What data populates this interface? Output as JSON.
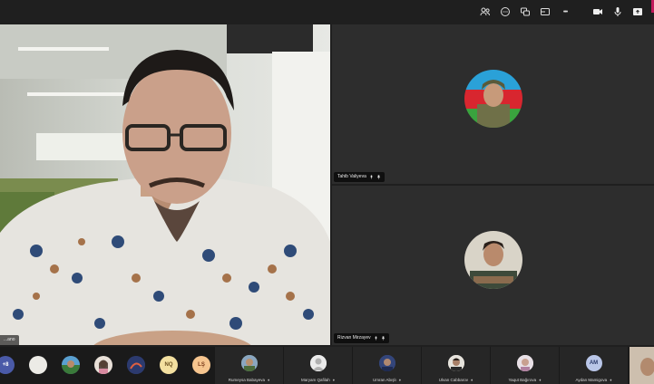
{
  "top_bar": {
    "icons": [
      "people-icon",
      "chat-icon",
      "reactions-icon",
      "rooms-icon",
      "more-icon",
      "camera-icon",
      "mic-icon",
      "share-icon"
    ],
    "more_label": "•••"
  },
  "main_video": {
    "name_tag": "...ano"
  },
  "tiles": [
    {
      "name": "Tahib Valiyeva"
    },
    {
      "name": "Rizvan Mirzayev"
    }
  ],
  "bottom_strip": {
    "overflow_count": "+8",
    "initials": [
      "NQ",
      "LŞ"
    ],
    "participants": [
      {
        "name": "Rumeysa Babayeva",
        "initials": ""
      },
      {
        "name": "Maryam Qafilah",
        "initials": ""
      },
      {
        "name": "Umran Abışlı",
        "initials": ""
      },
      {
        "name": "Ulvan Cabbarov",
        "initials": ""
      },
      {
        "name": "Yaqut Bağırova",
        "initials": ""
      },
      {
        "name": "Aydan Mamigova",
        "initials": "AM"
      }
    ]
  },
  "colors": {
    "background": "#1f1f1f",
    "tile": "#2d2d2d",
    "accent_pink": "#c2185b",
    "nq_avatar": "#f3e0a0",
    "ls_avatar": "#f6c58f",
    "am_avatar": "#b9c6e8"
  }
}
